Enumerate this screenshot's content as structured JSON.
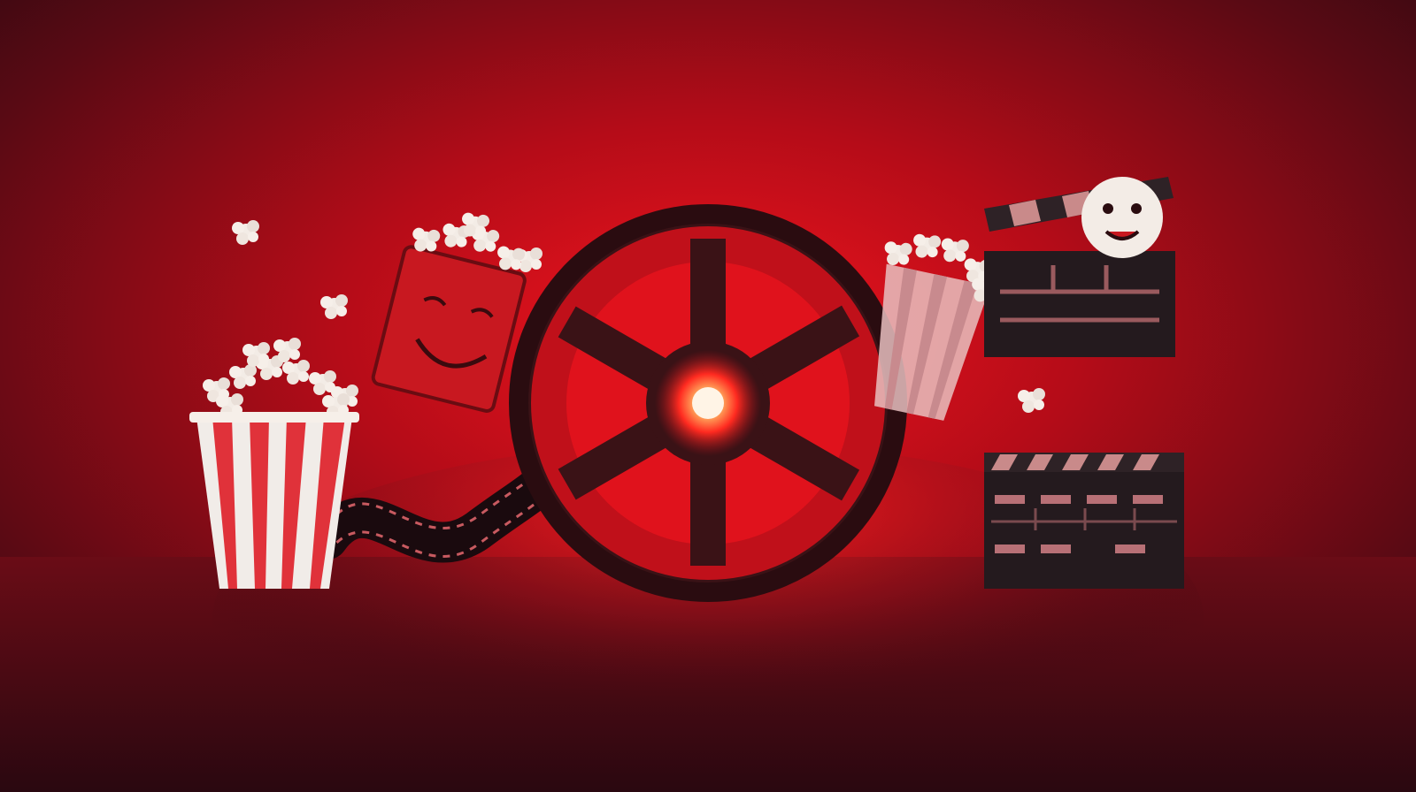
{
  "scene": {
    "palette": {
      "backdrop_glow": "#e0121c",
      "backdrop_edge": "#2a0810",
      "floor_glow": "#ff1a1a",
      "reel": "#3a1216",
      "reel_light": "#ff4040",
      "popcorn": "#f3ece6",
      "stripe_red": "#e0323a",
      "stripe_white": "#f1ece8",
      "clapper": "#241a1e",
      "clapper_stripe": "#c98a8a"
    },
    "icons": [
      "film-reel-icon",
      "popcorn-bucket-icon",
      "film-strip-icon",
      "clapperboard-icon",
      "popcorn-kernel-icon"
    ]
  }
}
